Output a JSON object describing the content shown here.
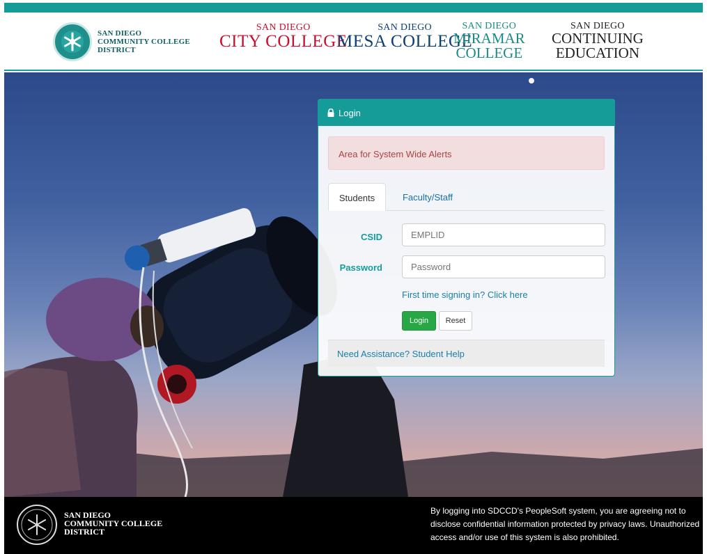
{
  "header": {
    "district": {
      "line1": "SAN DIEGO",
      "line2": "COMMUNITY COLLEGE",
      "line3": "DISTRICT"
    },
    "colleges": [
      {
        "small": "SAN DIEGO",
        "big": "CITY COLLEGE"
      },
      {
        "small": "SAN DIEGO",
        "big": "MESA COLLEGE"
      },
      {
        "small": "SAN DIEGO",
        "big1": "MIRAMAR",
        "big2": "COLLEGE"
      },
      {
        "small": "SAN DIEGO",
        "big1": "CONTINUING",
        "big2": "EDUCATION"
      }
    ]
  },
  "login": {
    "title": "Login",
    "alert": "Area for System Wide Alerts",
    "tabs": [
      "Students",
      "Faculty/Staff"
    ],
    "csid_label": "CSID",
    "csid_placeholder": "EMPLID",
    "password_label": "Password",
    "password_placeholder": "Password",
    "first_time_link": "First time signing in? Click here",
    "login_button": "Login",
    "reset_button": "Reset",
    "help_link": "Need Assistance? Student Help"
  },
  "footer": {
    "name_line1": "SAN DIEGO",
    "name_line2": "COMMUNITY COLLEGE",
    "name_line3": "DISTRICT",
    "disclaimer": "By logging into SDCCD's PeopleSoft system, you are agreeing not to disclose confidential information protected by privacy laws. Unauthorized access and/or use of this system is also prohibited."
  },
  "colors": {
    "teal": "#169c98",
    "alert_bg": "#f2dede",
    "alert_text": "#a94442",
    "login_green": "#28a745",
    "link_blue": "#1a7fa8"
  },
  "icons": [
    "district-seal-icon",
    "lock-icon",
    "telescope-hero-image"
  ]
}
